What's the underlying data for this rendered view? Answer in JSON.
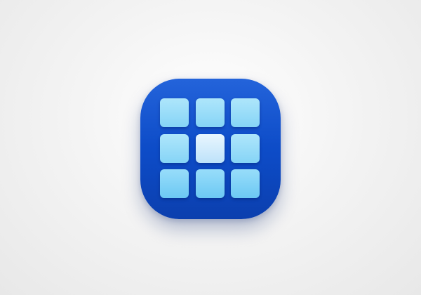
{
  "app_icon": {
    "icon": "grid-app-icon",
    "background_color": "#0d4bc6",
    "grid": {
      "rows": 3,
      "columns": 3,
      "tiles": [
        {
          "tone": "light"
        },
        {
          "tone": "light"
        },
        {
          "tone": "light"
        },
        {
          "tone": "light"
        },
        {
          "tone": "center-highlight"
        },
        {
          "tone": "light"
        },
        {
          "tone": "medium"
        },
        {
          "tone": "medium"
        },
        {
          "tone": "medium"
        }
      ],
      "tile_colors": {
        "light": "#9cdcf8",
        "medium": "#7fd0f5",
        "center-highlight": "#d4eefc"
      }
    }
  }
}
